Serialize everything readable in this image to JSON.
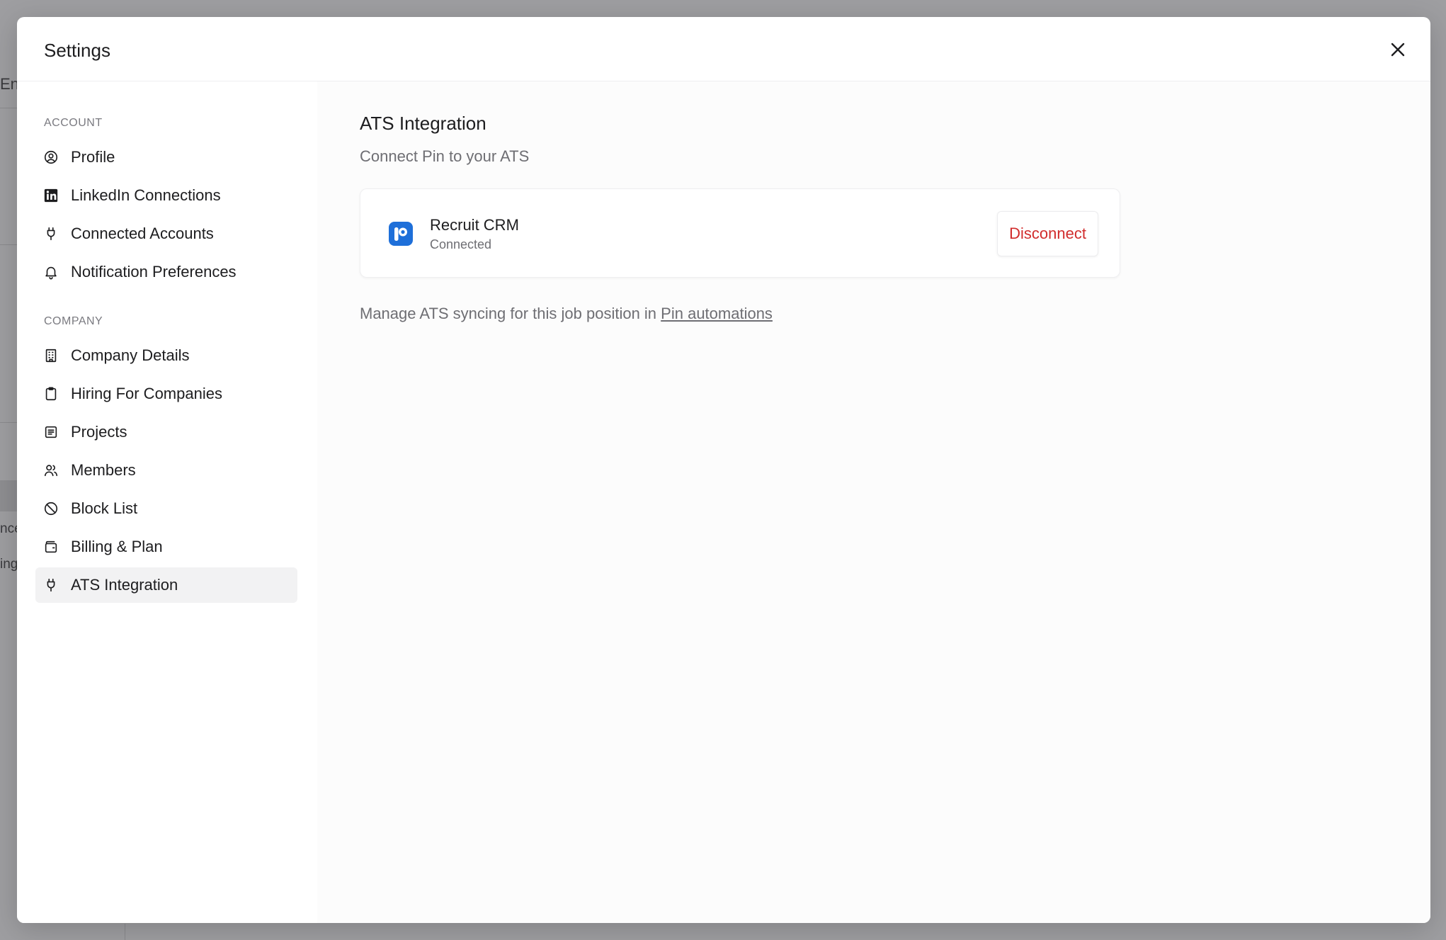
{
  "background": {
    "fragments": [
      "En",
      "nce",
      "ing"
    ]
  },
  "modal": {
    "title": "Settings"
  },
  "sidebar": {
    "sections": [
      {
        "label": "ACCOUNT",
        "items": [
          {
            "label": "Profile",
            "icon": "user-circle-icon"
          },
          {
            "label": "LinkedIn Connections",
            "icon": "linkedin-icon"
          },
          {
            "label": "Connected Accounts",
            "icon": "plug-icon"
          },
          {
            "label": "Notification Preferences",
            "icon": "bell-icon"
          }
        ]
      },
      {
        "label": "COMPANY",
        "items": [
          {
            "label": "Company Details",
            "icon": "building-icon"
          },
          {
            "label": "Hiring For Companies",
            "icon": "clipboard-icon"
          },
          {
            "label": "Projects",
            "icon": "list-box-icon"
          },
          {
            "label": "Members",
            "icon": "users-icon"
          },
          {
            "label": "Block List",
            "icon": "ban-icon"
          },
          {
            "label": "Billing & Plan",
            "icon": "wallet-icon"
          },
          {
            "label": "ATS Integration",
            "icon": "plug-icon",
            "active": true
          }
        ]
      }
    ]
  },
  "content": {
    "title": "ATS Integration",
    "subtitle": "Connect Pin to your ATS",
    "integration": {
      "name": "Recruit CRM",
      "status": "Connected",
      "action_label": "Disconnect",
      "action_color": "#d12d2d",
      "logo_color": "#1e6fd9"
    },
    "manage_text": "Manage ATS syncing for this job position in",
    "manage_link": "Pin automations"
  }
}
